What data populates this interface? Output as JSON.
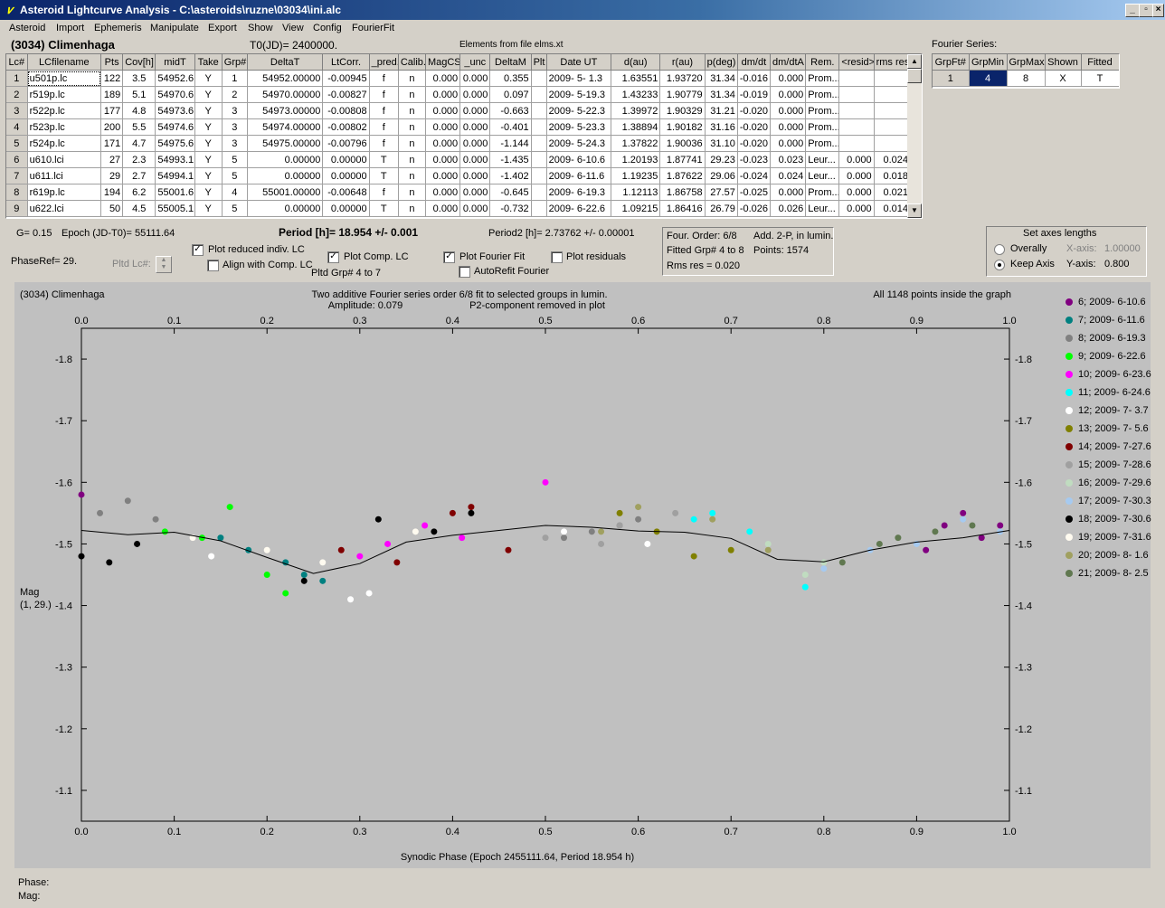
{
  "window": {
    "title": "Asteroid Lightcurve Analysis - C:\\asteroids\\ruzne\\03034\\ini.alc",
    "min": "_",
    "max": "▫",
    "close": "×"
  },
  "menu": [
    "Asteroid",
    "Import",
    "Ephemeris",
    "Manipulate",
    "Export",
    "Show",
    "View",
    "Config",
    "FourierFit"
  ],
  "header": {
    "asteroid": "(3034) Climenhaga",
    "t0": "T0(JD)= 2400000.",
    "elements": "Elements from file elms.xt",
    "fourier_title": "Fourier Series:"
  },
  "table": {
    "columns": [
      "Lc#",
      "LCfilename",
      "Pts",
      "Cov[h]",
      "midT",
      "Take",
      "Grp#",
      "DeltaT",
      "LtCorr.",
      "_pred.",
      "Calib.",
      "MagCS",
      "_unc",
      "DeltaM",
      "Plt",
      "Date UT",
      "d(au)",
      "r(au)",
      "p(deg)",
      "dm/dt",
      "dm/dtA",
      "Rem.",
      "<resid>",
      "rms res"
    ],
    "rows": [
      [
        "1",
        "u501p.lc",
        "122",
        "3.5",
        "54952.6",
        "Y",
        "1",
        "54952.00000",
        "-0.00945",
        "f",
        "n",
        "0.000",
        "0.000",
        "0.355",
        "",
        "2009- 5- 1.3",
        "1.63551",
        "1.93720",
        "31.34",
        "-0.016",
        "0.000",
        "Prom...",
        "",
        ""
      ],
      [
        "2",
        "r519p.lc",
        "189",
        "5.1",
        "54970.6",
        "Y",
        "2",
        "54970.00000",
        "-0.00827",
        "f",
        "n",
        "0.000",
        "0.000",
        "0.097",
        "",
        "2009- 5-19.3",
        "1.43233",
        "1.90779",
        "31.34",
        "-0.019",
        "0.000",
        "Prom...",
        "",
        ""
      ],
      [
        "3",
        "r522p.lc",
        "177",
        "4.8",
        "54973.6",
        "Y",
        "3",
        "54973.00000",
        "-0.00808",
        "f",
        "n",
        "0.000",
        "0.000",
        "-0.663",
        "",
        "2009- 5-22.3",
        "1.39972",
        "1.90329",
        "31.21",
        "-0.020",
        "0.000",
        "Prom...",
        "",
        ""
      ],
      [
        "4",
        "r523p.lc",
        "200",
        "5.5",
        "54974.6",
        "Y",
        "3",
        "54974.00000",
        "-0.00802",
        "f",
        "n",
        "0.000",
        "0.000",
        "-0.401",
        "",
        "2009- 5-23.3",
        "1.38894",
        "1.90182",
        "31.16",
        "-0.020",
        "0.000",
        "Prom...",
        "",
        ""
      ],
      [
        "5",
        "r524p.lc",
        "171",
        "4.7",
        "54975.6",
        "Y",
        "3",
        "54975.00000",
        "-0.00796",
        "f",
        "n",
        "0.000",
        "0.000",
        "-1.144",
        "",
        "2009- 5-24.3",
        "1.37822",
        "1.90036",
        "31.10",
        "-0.020",
        "0.000",
        "Prom...",
        "",
        ""
      ],
      [
        "6",
        "u610.lci",
        "27",
        "2.3",
        "54993.1",
        "Y",
        "5",
        "0.00000",
        "0.00000",
        "T",
        "n",
        "0.000",
        "0.000",
        "-1.435",
        "",
        "2009- 6-10.6",
        "1.20193",
        "1.87741",
        "29.23",
        "-0.023",
        "0.023",
        "Leur...",
        "0.000",
        "0.024"
      ],
      [
        "7",
        "u611.lci",
        "29",
        "2.7",
        "54994.1",
        "Y",
        "5",
        "0.00000",
        "0.00000",
        "T",
        "n",
        "0.000",
        "0.000",
        "-1.402",
        "",
        "2009- 6-11.6",
        "1.19235",
        "1.87622",
        "29.06",
        "-0.024",
        "0.024",
        "Leur...",
        "0.000",
        "0.018"
      ],
      [
        "8",
        "r619p.lc",
        "194",
        "6.2",
        "55001.6",
        "Y",
        "4",
        "55001.00000",
        "-0.00648",
        "f",
        "n",
        "0.000",
        "0.000",
        "-0.645",
        "",
        "2009- 6-19.3",
        "1.12113",
        "1.86758",
        "27.57",
        "-0.025",
        "0.000",
        "Prom...",
        "0.000",
        "0.021"
      ],
      [
        "9",
        "u622.lci",
        "50",
        "4.5",
        "55005.1",
        "Y",
        "5",
        "0.00000",
        "0.00000",
        "T",
        "n",
        "0.000",
        "0.000",
        "-0.732",
        "",
        "2009- 6-22.6",
        "1.09215",
        "1.86416",
        "26.79",
        "-0.026",
        "0.026",
        "Leur...",
        "0.000",
        "0.014"
      ]
    ]
  },
  "fourier_table": {
    "columns": [
      "GrpFt#",
      "GrpMin",
      "GrpMax",
      "Shown",
      "Fitted"
    ],
    "row": [
      "1",
      "4",
      "8",
      "X",
      "T"
    ]
  },
  "controls": {
    "g": "G= 0.15",
    "epoch": "Epoch (JD-T0)= 55111.64",
    "phaseref": "PhaseRef= 29.",
    "pltdlc": "Pltd Lc#:",
    "period": "Period [h]= 18.954 +/- 0.001",
    "period2": "Period2 [h]= 2.73762 +/- 0.00001",
    "plot_reduced": "Plot reduced indiv. LC",
    "align": "Align with Comp. LC",
    "plot_comp": "Plot Comp. LC",
    "pltd_grp": "Pltd Grp#  4   to    7",
    "plot_fourier": "Plot Fourier Fit",
    "autorefit": "AutoRefit Fourier",
    "plot_residuals": "Plot residuals",
    "four_order": "Four. Order:  6/8",
    "add2p": "Add. 2-P, in lumin.",
    "fitted_grp": "Fitted Grp# 4 to 8",
    "points": "Points: 1574",
    "rms": "Rms res     = 0.020",
    "axes_title": "Set axes lengths",
    "overally": "Overally",
    "keep_axis": "Keep Axis",
    "xaxis_label": "X-axis:",
    "xaxis_val": "1.00000",
    "yaxis_label": "Y-axis:",
    "yaxis_val": "0.800"
  },
  "plot": {
    "name": "(3034) Climenhaga",
    "subtitle1": "Two additive Fourier series order 6/8 fit to selected groups in lumin.",
    "subtitle2": "Amplitude: 0.079",
    "subtitle3": "P2-component removed in plot",
    "info": "All 1148 points inside the graph",
    "xlabel": "Synodic Phase (Epoch 2455111.64, Period 18.954 h)",
    "ylabel1": "Mag",
    "ylabel2": "(1, 29.)"
  },
  "legend": [
    {
      "label": "6; 2009- 6-10.6",
      "color": "#800080"
    },
    {
      "label": "7; 2009- 6-11.6",
      "color": "#008080"
    },
    {
      "label": "8; 2009- 6-19.3",
      "color": "#808080"
    },
    {
      "label": "9; 2009- 6-22.6",
      "color": "#00ff00"
    },
    {
      "label": "10; 2009- 6-23.6",
      "color": "#ff00ff"
    },
    {
      "label": "11; 2009- 6-24.6",
      "color": "#00ffff"
    },
    {
      "label": "12; 2009- 7- 3.7",
      "color": "#ffffff"
    },
    {
      "label": "13; 2009- 7- 5.6",
      "color": "#808000"
    },
    {
      "label": "14; 2009- 7-27.6",
      "color": "#800000"
    },
    {
      "label": "15; 2009- 7-28.6",
      "color": "#a0a0a0"
    },
    {
      "label": "16; 2009- 7-29.6",
      "color": "#c0dcc0"
    },
    {
      "label": "17; 2009- 7-30.3",
      "color": "#a6caf0"
    },
    {
      "label": "18; 2009- 7-30.6",
      "color": "#000000"
    },
    {
      "label": "19; 2009- 7-31.6",
      "color": "#fffbf0"
    },
    {
      "label": "20; 2009- 8- 1.6",
      "color": "#a0a060"
    },
    {
      "label": "21; 2009- 8- 2.5",
      "color": "#607850"
    }
  ],
  "status": {
    "phase": "Phase:",
    "mag": "Mag:"
  },
  "chart_data": {
    "type": "scatter",
    "xlim": [
      0.0,
      1.0
    ],
    "ylim": [
      -1.85,
      -1.05
    ],
    "y_inverted": true,
    "x_ticks": [
      "0.0",
      "0.1",
      "0.2",
      "0.3",
      "0.4",
      "0.5",
      "0.6",
      "0.7",
      "0.8",
      "0.9",
      "1.0"
    ],
    "y_ticks": [
      "-1.8",
      "-1.7",
      "-1.6",
      "-1.5",
      "-1.4",
      "-1.3",
      "-1.2",
      "-1.1"
    ],
    "fit_curve": {
      "x": [
        0.0,
        0.05,
        0.1,
        0.15,
        0.2,
        0.25,
        0.3,
        0.35,
        0.4,
        0.45,
        0.5,
        0.55,
        0.6,
        0.65,
        0.7,
        0.75,
        0.8,
        0.85,
        0.9,
        0.95,
        1.0
      ],
      "y": [
        -1.522,
        -1.515,
        -1.519,
        -1.505,
        -1.478,
        -1.452,
        -1.468,
        -1.503,
        -1.514,
        -1.522,
        -1.53,
        -1.527,
        -1.521,
        -1.519,
        -1.509,
        -1.475,
        -1.471,
        -1.49,
        -1.503,
        -1.51,
        -1.522
      ]
    },
    "series": [
      {
        "name": "6; 2009- 6-10.6",
        "x": [
          0.0,
          0.91,
          0.93,
          0.95,
          0.97,
          0.99
        ],
        "y": [
          -1.58,
          -1.49,
          -1.53,
          -1.55,
          -1.51,
          -1.53
        ]
      },
      {
        "name": "7; 2009- 6-11.6",
        "x": [
          0.15,
          0.18,
          0.22,
          0.24,
          0.26
        ],
        "y": [
          -1.51,
          -1.49,
          -1.47,
          -1.45,
          -1.44
        ]
      },
      {
        "name": "8; 2009- 6-19.3",
        "x": [
          0.02,
          0.05,
          0.08,
          0.52,
          0.55,
          0.58,
          0.6
        ],
        "y": [
          -1.55,
          -1.57,
          -1.54,
          -1.51,
          -1.52,
          -1.53,
          -1.54
        ]
      },
      {
        "name": "9; 2009- 6-22.6",
        "x": [
          0.09,
          0.13,
          0.16,
          0.2,
          0.22
        ],
        "y": [
          -1.52,
          -1.51,
          -1.56,
          -1.45,
          -1.42
        ]
      },
      {
        "name": "10; 2009- 6-23.6",
        "x": [
          0.3,
          0.33,
          0.37,
          0.41,
          0.5
        ],
        "y": [
          -1.48,
          -1.5,
          -1.53,
          -1.51,
          -1.6
        ]
      },
      {
        "name": "11; 2009- 6-24.6",
        "x": [
          0.66,
          0.68,
          0.72,
          0.78
        ],
        "y": [
          -1.54,
          -1.55,
          -1.52,
          -1.43
        ]
      },
      {
        "name": "12; 2009- 7- 3.7",
        "x": [
          0.14,
          0.29,
          0.31,
          0.52,
          0.61
        ],
        "y": [
          -1.48,
          -1.41,
          -1.42,
          -1.52,
          -1.5
        ]
      },
      {
        "name": "13; 2009- 7- 5.6",
        "x": [
          0.58,
          0.62,
          0.66,
          0.7
        ],
        "y": [
          -1.55,
          -1.52,
          -1.48,
          -1.49
        ]
      },
      {
        "name": "14; 2009- 7-27.6",
        "x": [
          0.28,
          0.34,
          0.4,
          0.42,
          0.46
        ],
        "y": [
          -1.49,
          -1.47,
          -1.55,
          -1.56,
          -1.49
        ]
      },
      {
        "name": "15; 2009- 7-28.6",
        "x": [
          0.5,
          0.56,
          0.58,
          0.64
        ],
        "y": [
          -1.51,
          -1.5,
          -1.53,
          -1.55
        ]
      },
      {
        "name": "16; 2009- 7-29.6",
        "x": [
          0.74,
          0.78,
          0.8
        ],
        "y": [
          -1.5,
          -1.45,
          -1.47
        ]
      },
      {
        "name": "17; 2009- 7-30.3",
        "x": [
          0.8,
          0.85,
          0.9,
          0.95,
          0.99
        ],
        "y": [
          -1.46,
          -1.49,
          -1.5,
          -1.54,
          -1.52
        ]
      },
      {
        "name": "18; 2009- 7-30.6",
        "x": [
          0.0,
          0.03,
          0.06,
          0.24,
          0.32,
          0.38,
          0.42
        ],
        "y": [
          -1.48,
          -1.47,
          -1.5,
          -1.44,
          -1.54,
          -1.52,
          -1.55
        ]
      },
      {
        "name": "19; 2009- 7-31.6",
        "x": [
          0.12,
          0.2,
          0.26,
          0.36
        ],
        "y": [
          -1.51,
          -1.49,
          -1.47,
          -1.52
        ]
      },
      {
        "name": "20; 2009- 8- 1.6",
        "x": [
          0.56,
          0.6,
          0.68,
          0.74
        ],
        "y": [
          -1.52,
          -1.56,
          -1.54,
          -1.49
        ]
      },
      {
        "name": "21; 2009- 8- 2.5",
        "x": [
          0.82,
          0.86,
          0.88,
          0.92,
          0.96
        ],
        "y": [
          -1.47,
          -1.5,
          -1.51,
          -1.52,
          -1.53
        ]
      }
    ]
  }
}
